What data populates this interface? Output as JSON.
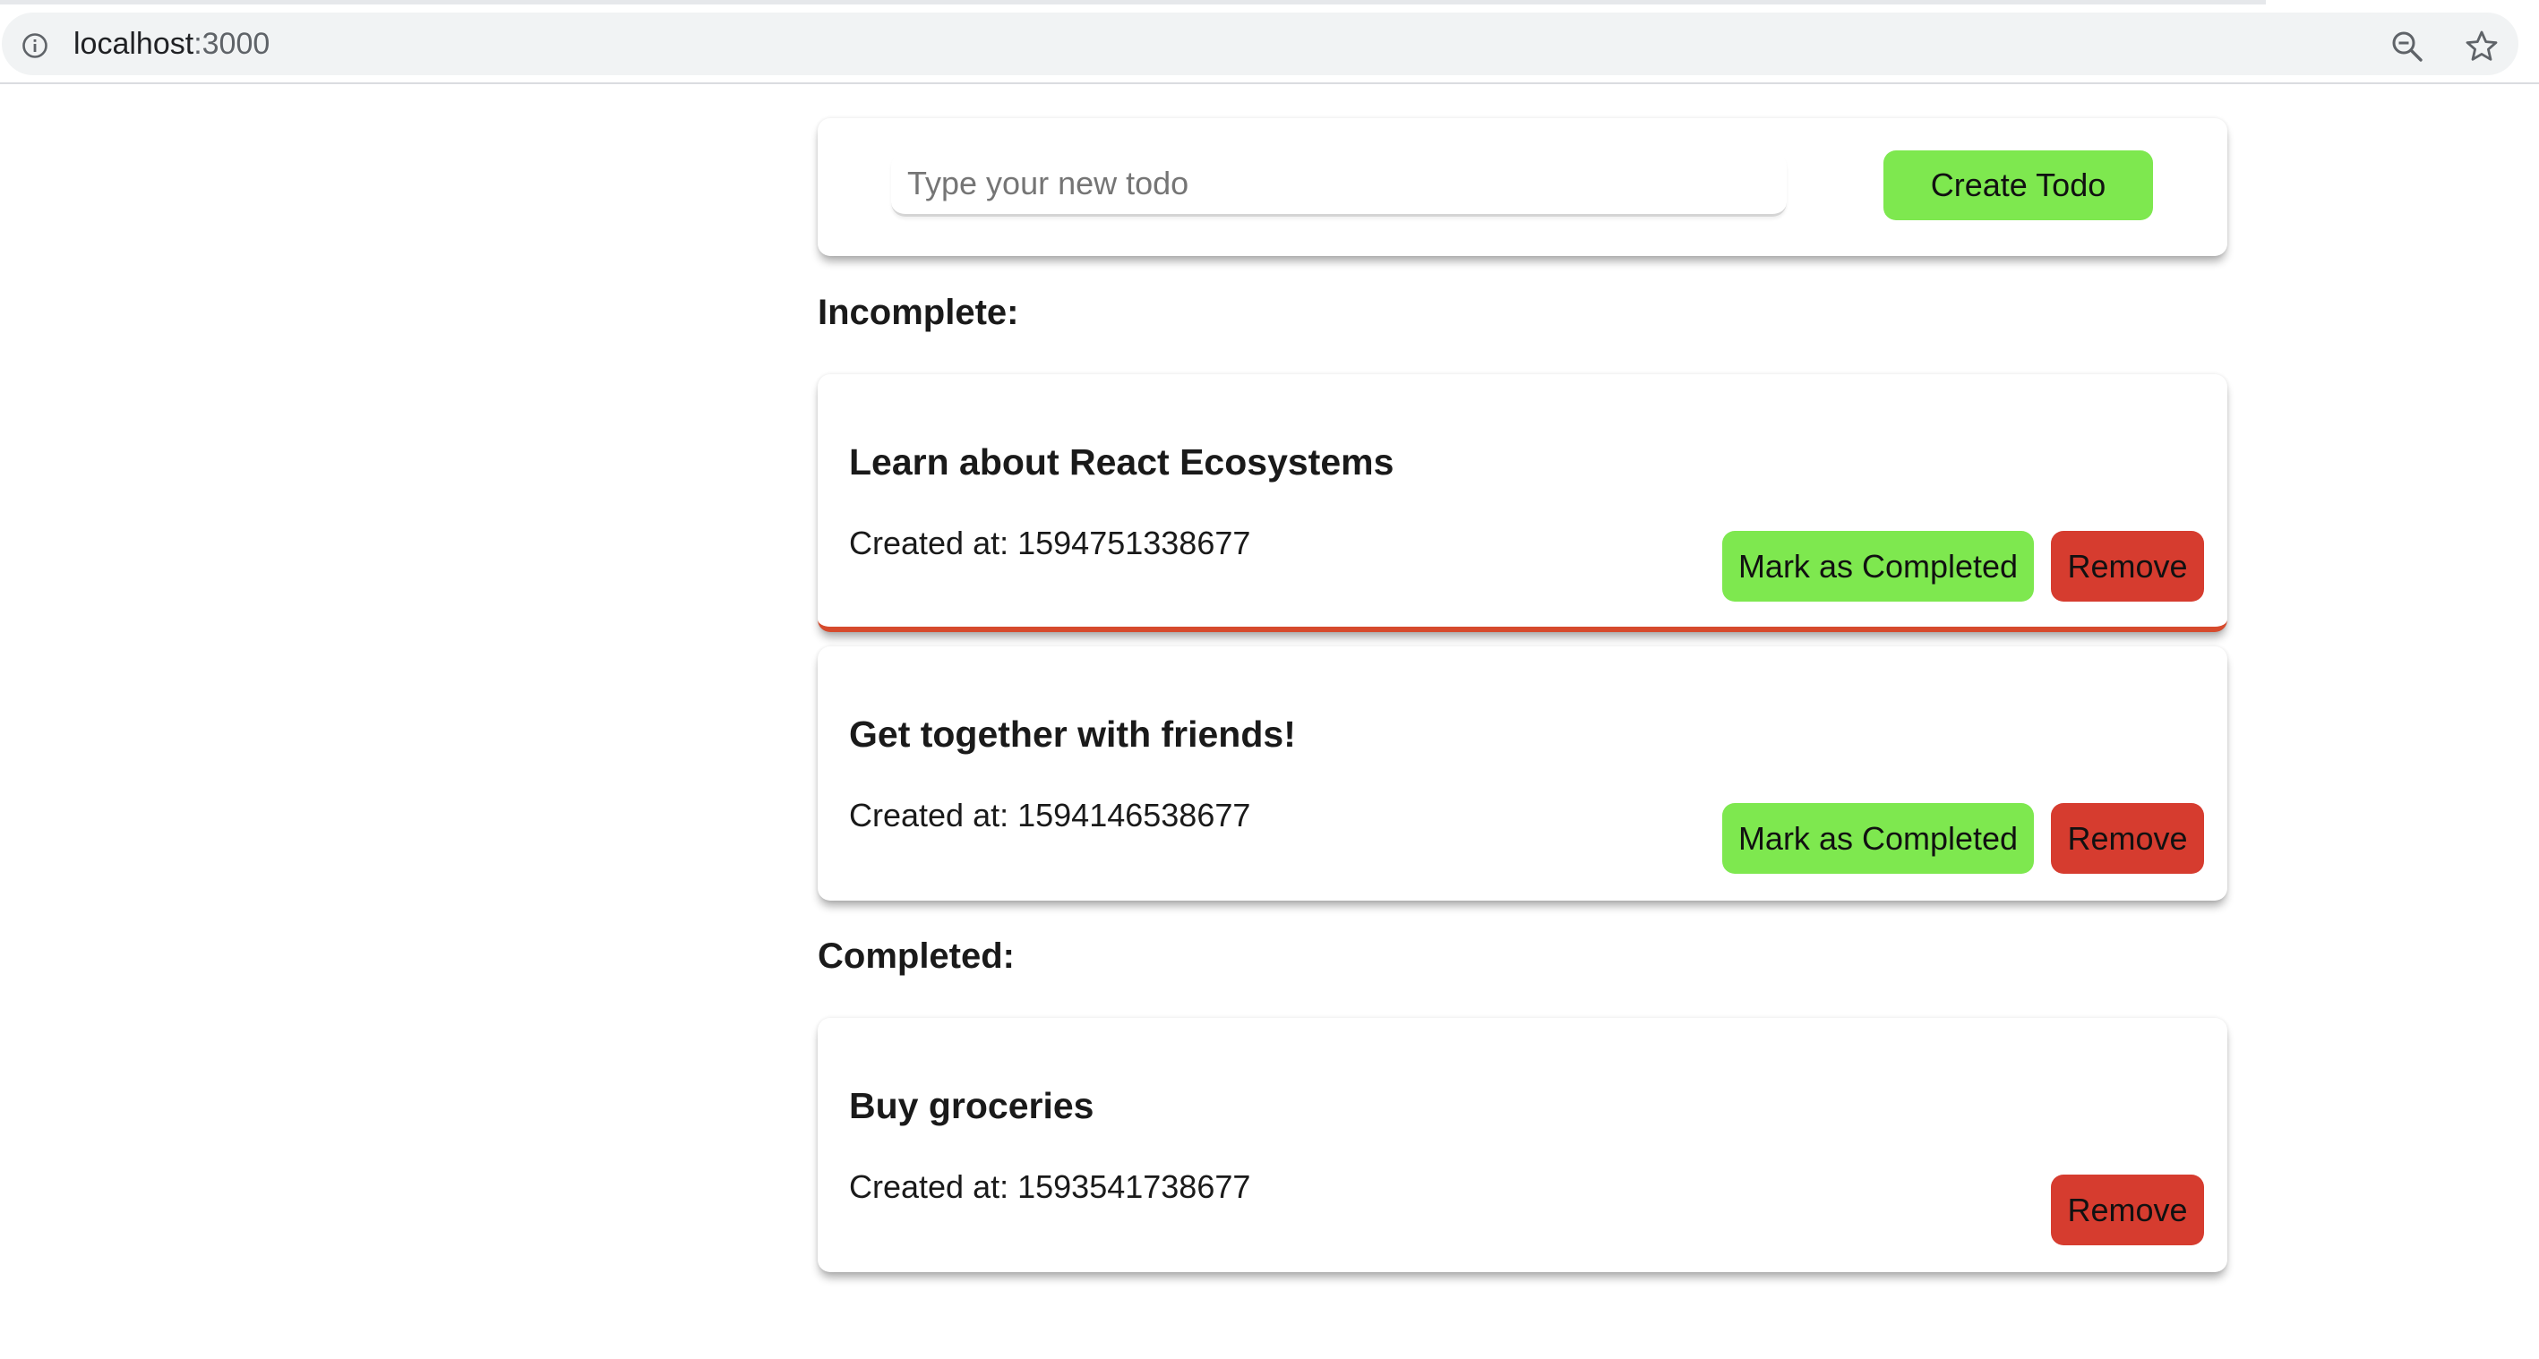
{
  "browser": {
    "url_host": "localhost",
    "url_port": ":3000"
  },
  "new_todo_form": {
    "placeholder": "Type your new todo",
    "create_label": "Create Todo"
  },
  "sections": {
    "incomplete_heading": "Incomplete:",
    "completed_heading": "Completed:"
  },
  "todos": {
    "incomplete": [
      {
        "text": "Learn about React Ecosystems",
        "created_label": "Created at:",
        "created_at": "1594751338677",
        "complete_label": "Mark as Completed",
        "remove_label": "Remove"
      },
      {
        "text": "Get together with friends!",
        "created_label": "Created at:",
        "created_at": "1594146538677",
        "complete_label": "Mark as Completed",
        "remove_label": "Remove"
      }
    ],
    "completed": [
      {
        "text": "Buy groceries",
        "created_label": "Created at:",
        "created_at": "1593541738677",
        "remove_label": "Remove"
      }
    ]
  },
  "colors": {
    "complete_button": "#7ee84f",
    "remove_button": "#d63c2f",
    "overdue_border": "#d64a2c"
  },
  "icons": {
    "site_info": "info-icon",
    "zoom": "zoom-out-icon",
    "bookmark": "star-icon"
  }
}
